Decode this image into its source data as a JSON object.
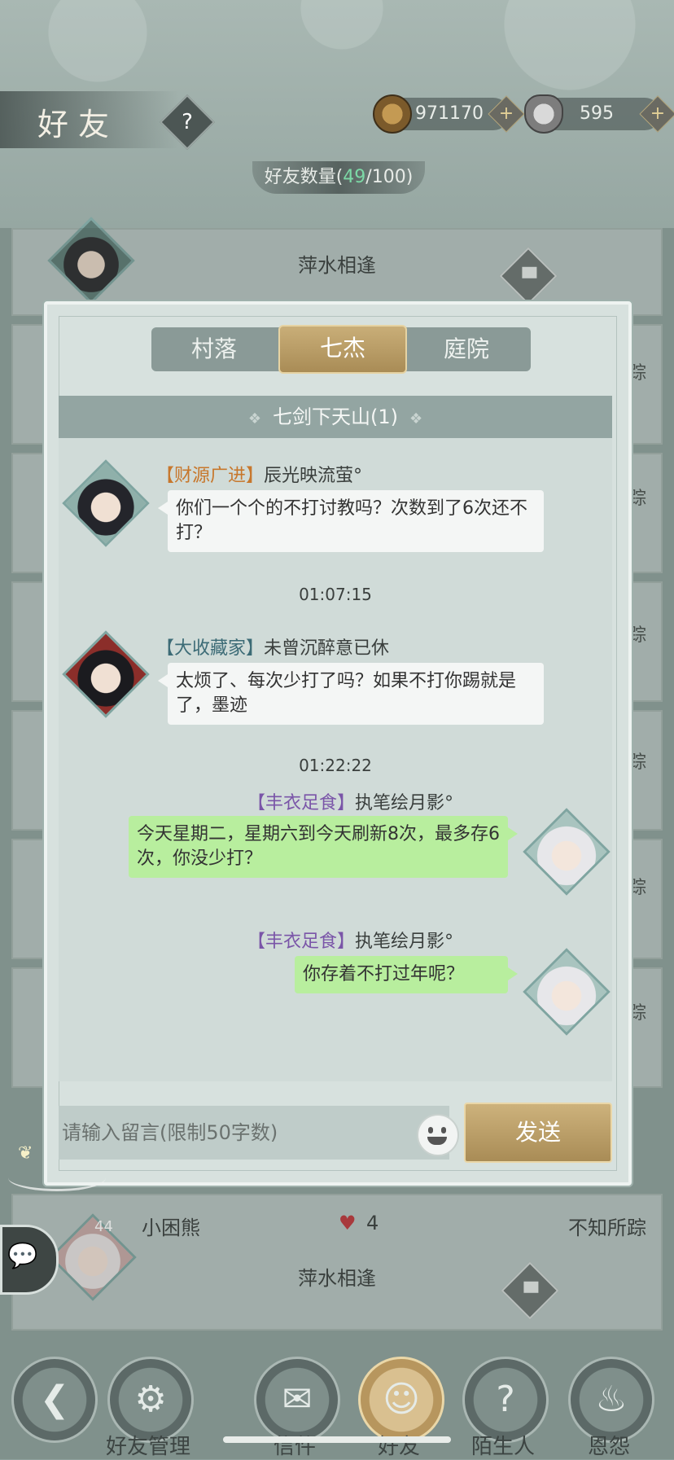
{
  "header": {
    "title": "好友",
    "help_glyph": "?",
    "copper": "971170",
    "silver": "595",
    "plus_glyph": "+",
    "friend_count_prefix": "好友数量(",
    "friend_count_current": "49",
    "friend_count_suffix": "/100)"
  },
  "list_behind": {
    "row1_place": "萍水相逢",
    "side_label": "踪",
    "last_row": {
      "name": "小困熊",
      "level": "44",
      "heart_glyph": "♥",
      "hearts": "4",
      "status": "不知所踪",
      "place": "萍水相逢"
    }
  },
  "modal": {
    "tabs": [
      "村落",
      "七杰",
      "庭院"
    ],
    "active_tab": "七杰",
    "channel_title": "七剑下天山(1)",
    "channel_dot": "❖",
    "messages": [
      {
        "tag": "【财源广进】",
        "name": "辰光映流萤°",
        "text": "你们一个个的不打讨教吗？次数到了6次还不打？",
        "side": "left"
      },
      {
        "time": "01:07:15"
      },
      {
        "tag": "【大收藏家】",
        "name": "未曾沉醉意已休",
        "text": "太烦了、每次少打了吗？如果不打你踢就是了，墨迹",
        "side": "left"
      },
      {
        "time": "01:22:22"
      },
      {
        "tag": "【丰衣足食】",
        "name": "执笔绘月影°",
        "text": "今天星期二，星期六到今天刷新8次，最多存6次，你没少打？",
        "side": "right"
      },
      {
        "tag": "【丰衣足食】",
        "name": "执笔绘月影°",
        "text": "你存着不打过年呢？",
        "side": "right"
      }
    ],
    "input_placeholder": "请输入留言(限制50字数)",
    "send_label": "发送"
  },
  "bottom_nav": {
    "back_glyph": "❮",
    "friend_manage_glyph": "⚙",
    "friend_manage": "好友管理",
    "mail_glyph": "✉",
    "mail": "信件",
    "friends_glyph": "☺",
    "friends": "好友",
    "strangers_glyph": "?",
    "strangers": "陌生人",
    "grudges_glyph": "♨",
    "grudges": "恩怨",
    "chat_glyph": "💬"
  }
}
